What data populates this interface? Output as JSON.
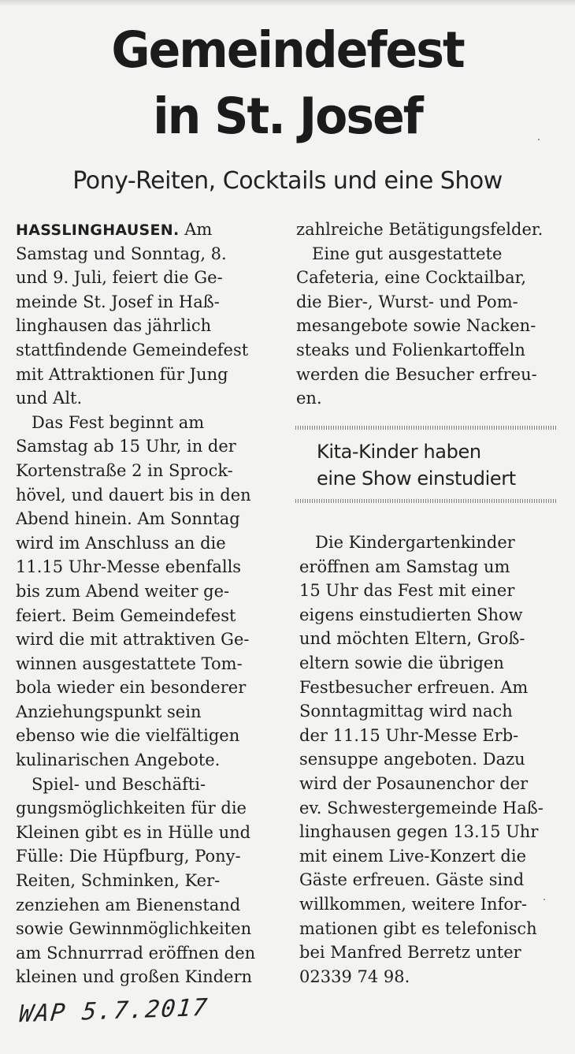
{
  "article": {
    "headline_line1": "Gemeindefest",
    "headline_line2": "in St. Josef",
    "subheadline": "Pony-Reiten, Cocktails und eine Show",
    "dateline": "HASSLINGHAUSEN.",
    "left_column": [
      " Am",
      "Samstag und Sonntag, 8.",
      "und 9. Juli, feiert die Ge-",
      "meinde St. Josef in Haß-",
      "linghausen das jährlich",
      "stattfindende Gemeindefest",
      "mit Attraktionen für Jung",
      "und Alt.",
      "   Das Fest beginnt am",
      "Samstag ab 15 Uhr, in der",
      "Kortenstraße 2 in Sprock-",
      "hövel, und dauert bis in den",
      "Abend hinein. Am Sonntag",
      "wird im Anschluss an die",
      "11.15 Uhr-Messe ebenfalls",
      "bis zum Abend weiter ge-",
      "feiert. Beim Gemeindefest",
      "wird die mit attraktiven Ge-",
      "winnen ausgestattete Tom-",
      "bola wieder ein besonderer",
      "Anziehungspunkt sein",
      "ebenso wie die vielfältigen",
      "kulinarischen Angebote.",
      "   Spiel- und Beschäfti-",
      "gungsmöglichkeiten für die",
      "Kleinen gibt es in Hülle und",
      "Fülle: Die Hüpfburg, Pony-",
      "Reiten, Schminken, Ker-",
      "zenziehen am Bienenstand",
      "sowie Gewinnmöglichkeiten",
      "am Schnurrrad eröffnen den",
      "kleinen und großen Kindern"
    ],
    "right_column_top": [
      "zahlreiche Betätigungsfelder.",
      "   Eine gut ausgestattete",
      "Cafeteria, eine Cocktailbar,",
      "die Bier-, Wurst- und Pom-",
      "mesangebote sowie Nacken-",
      "steaks und Folienkartoffeln",
      "werden die Besucher erfreu-",
      "en."
    ],
    "kicker_line1": "Kita-Kinder haben",
    "kicker_line2": "eine Show einstudiert",
    "right_column_bottom": [
      "   Die Kindergartenkinder",
      "eröffnen am Samstag um",
      "15 Uhr das Fest mit einer",
      "eigens einstudierten Show",
      "und möchten Eltern, Groß-",
      "eltern sowie die übrigen",
      "Festbesucher erfreuen. Am",
      "Sonntagmittag wird nach",
      "der 11.15 Uhr-Messe Erb-",
      "sensuppe angeboten. Dazu",
      "wird der Posaunenchor der",
      "ev. Schwestergemeinde Haß-",
      "linghausen gegen 13.15 Uhr",
      "mit einem Live-Konzert die",
      "Gäste erfreuen. Gäste sind",
      "willkommen, weitere Infor-",
      "mationen gibt es telefonisch",
      "bei Manfred Berretz unter",
      "02339 74 98."
    ]
  },
  "annotation": {
    "handwritten_source": "WAP 5.7.2017"
  }
}
